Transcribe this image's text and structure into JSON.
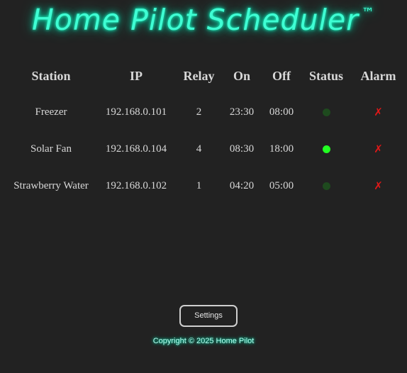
{
  "header": {
    "title": "Home Pilot Scheduler",
    "trademark": "™"
  },
  "table": {
    "columns": [
      "Station",
      "IP",
      "Relay",
      "On",
      "Off",
      "Status",
      "Alarm"
    ],
    "rows": [
      {
        "station": "Freezer",
        "ip": "192.168.0.101",
        "relay": "2",
        "on": "23:30",
        "off": "08:00",
        "status": "off",
        "status_color": "#1e4a1e",
        "alarm": "✗",
        "alarm_color": "#e01818"
      },
      {
        "station": "Solar Fan",
        "ip": "192.168.0.104",
        "relay": "4",
        "on": "08:30",
        "off": "18:00",
        "status": "on",
        "status_color": "#22ff22",
        "alarm": "✗",
        "alarm_color": "#e01818"
      },
      {
        "station": "Strawberry Water",
        "ip": "192.168.0.102",
        "relay": "1",
        "on": "04:20",
        "off": "05:00",
        "status": "off",
        "status_color": "#1e4a1e",
        "alarm": "✗",
        "alarm_color": "#e01818"
      }
    ]
  },
  "footer": {
    "settings_label": "Settings",
    "copyright": "Copyright © 2025 Home Pilot"
  },
  "colors": {
    "background": "#222222",
    "neon_accent": "#3fffd4",
    "status_on": "#22ff22",
    "status_off": "#1e4a1e",
    "alarm": "#e01818"
  }
}
